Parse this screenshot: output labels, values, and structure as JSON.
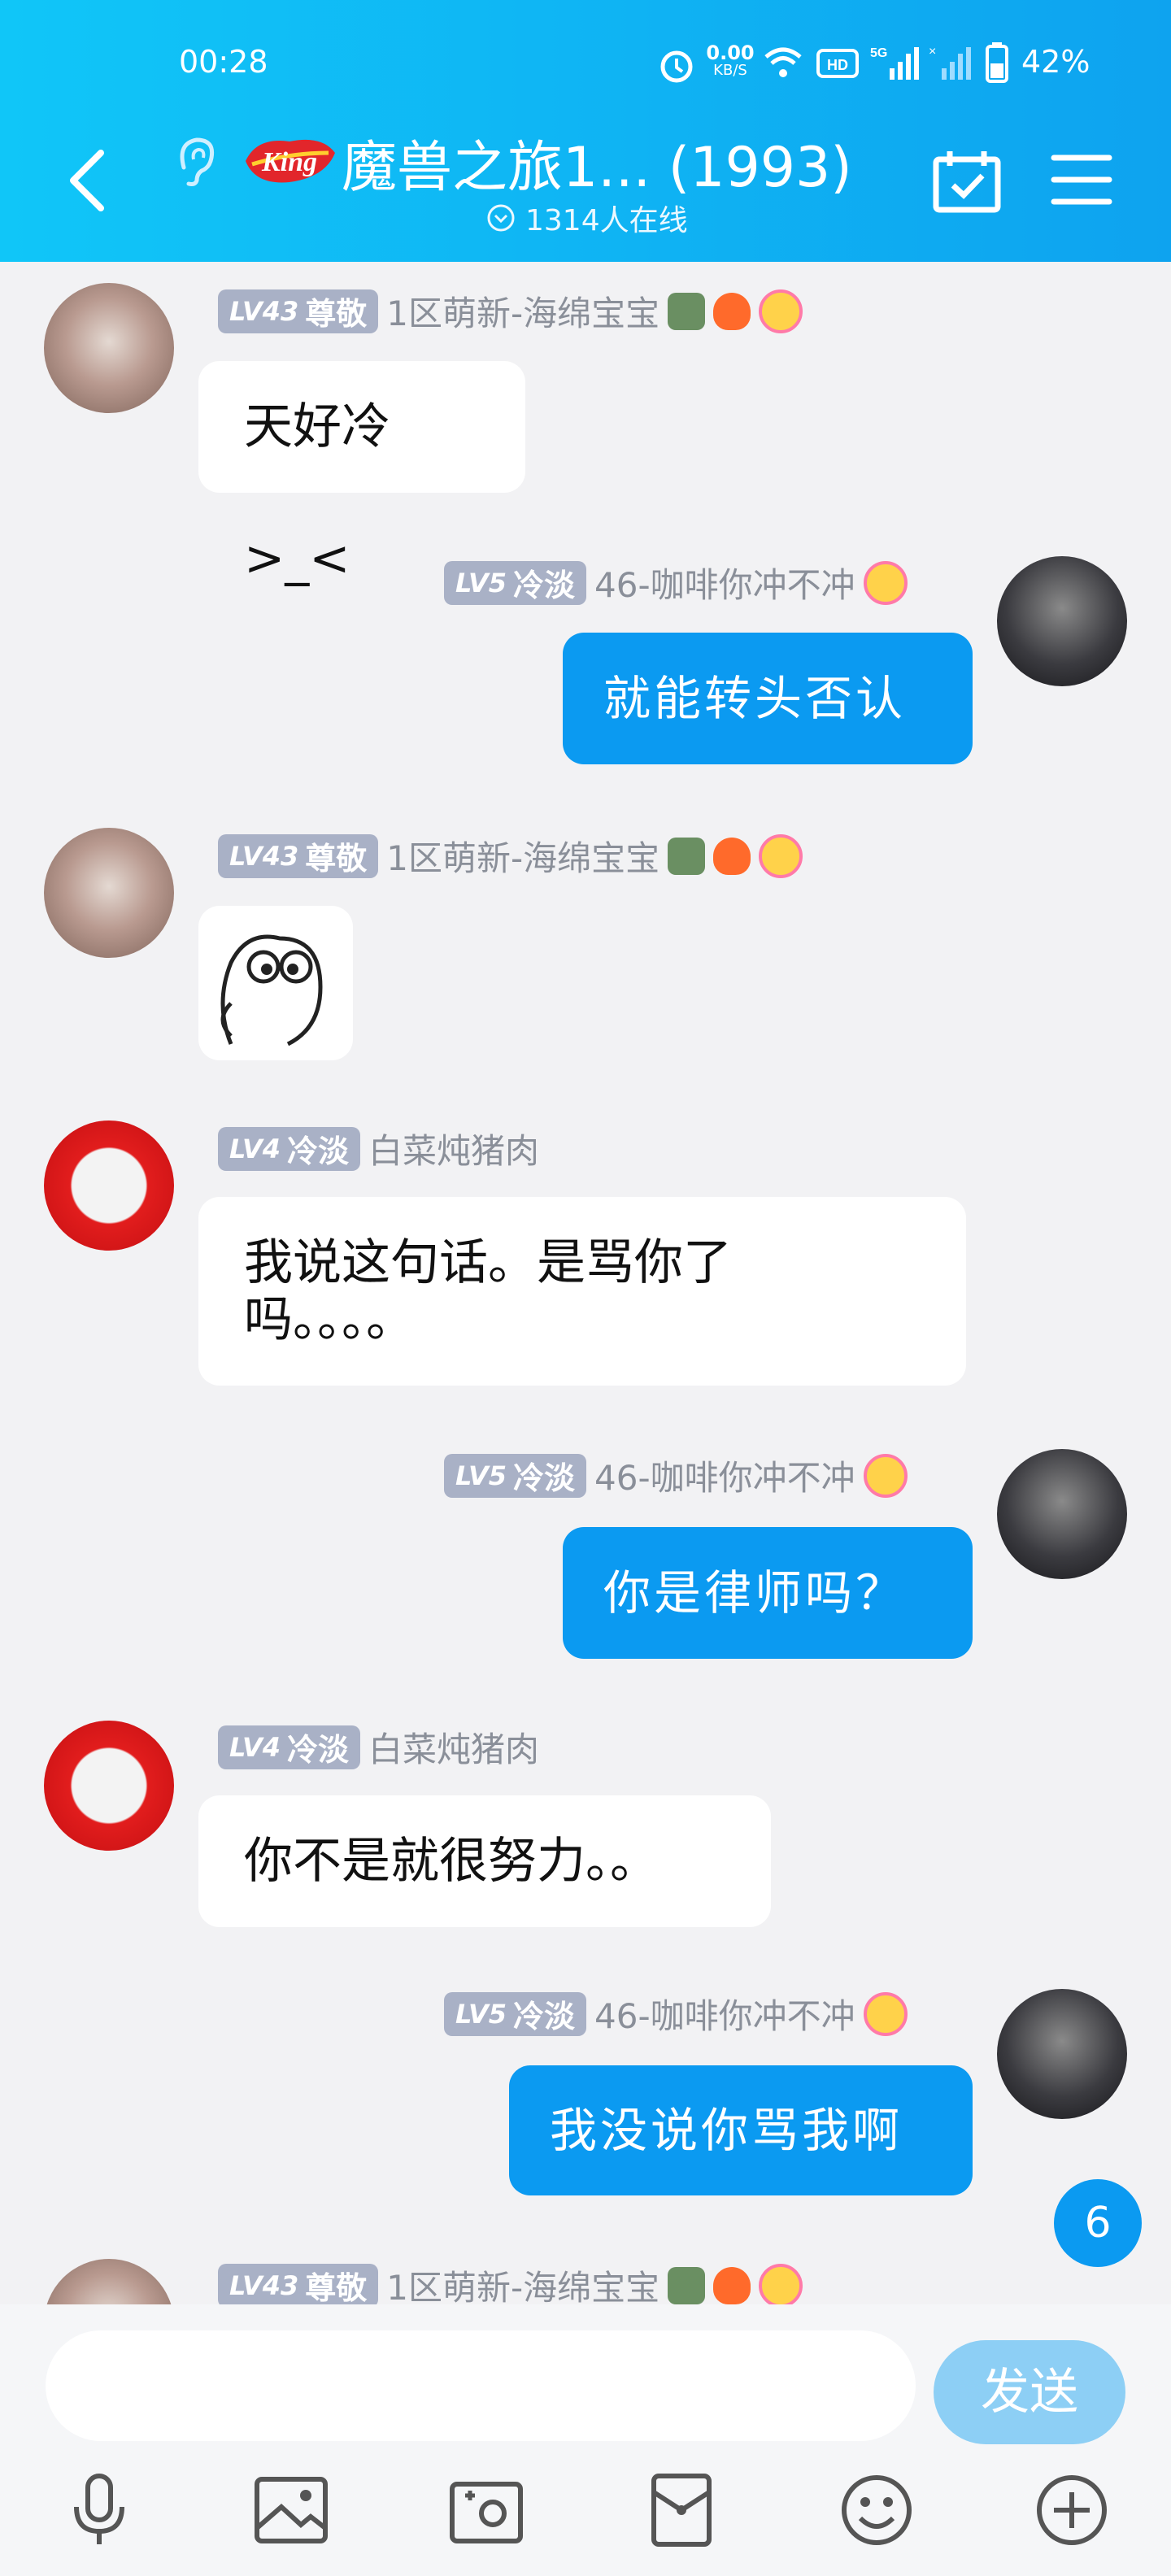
{
  "status_bar": {
    "time": "00:28",
    "net_speed_top": "0.00",
    "net_speed_unit": "KB/S",
    "battery": "42%"
  },
  "header": {
    "title": "魔兽之旅1... (1993)",
    "online": "1314人在线"
  },
  "messages": [
    {
      "side": "left",
      "level": "LV43",
      "title": "尊敬",
      "name": "1区萌新-海绵宝宝",
      "text": "天好冷>_<"
    },
    {
      "side": "right",
      "level": "LV5",
      "title": "冷淡",
      "name": "46-咖啡你冲不冲",
      "text": "就能转头否认"
    },
    {
      "side": "left",
      "level": "LV43",
      "title": "尊敬",
      "name": "1区萌新-海绵宝宝",
      "text": ""
    },
    {
      "side": "left",
      "level": "LV4",
      "title": "冷淡",
      "name": "白菜炖猪肉",
      "text_line1": "我说这句话。是骂你了",
      "text_line2": "吗。。。。"
    },
    {
      "side": "right",
      "level": "LV5",
      "title": "冷淡",
      "name": "46-咖啡你冲不冲",
      "text": "你是律师吗？"
    },
    {
      "side": "left",
      "level": "LV4",
      "title": "冷淡",
      "name": "白菜炖猪肉",
      "text": "你不是就很努力。。"
    },
    {
      "side": "right",
      "level": "LV5",
      "title": "冷淡",
      "name": "46-咖啡你冲不冲",
      "text": "我没说你骂我啊"
    },
    {
      "side": "left",
      "level": "LV43",
      "title": "尊敬",
      "name": "1区萌新-海绵宝宝",
      "text": ""
    }
  ],
  "unread_count": "6",
  "composer": {
    "input_value": "",
    "send_label": "发送"
  },
  "toolbar": [
    "microphone-icon",
    "image-icon",
    "camera-icon",
    "red-packet-icon",
    "emoji-icon",
    "plus-icon"
  ],
  "colors": {
    "header": "#0ea3ef",
    "bubble_right": "#0b9af1",
    "badge": "#a9b1c6",
    "send_disabled": "#8dcff5"
  }
}
